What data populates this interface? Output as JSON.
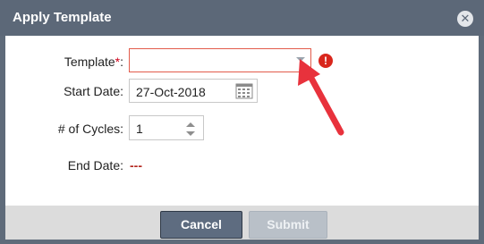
{
  "dialog": {
    "title": "Apply Template",
    "close_icon": "close-circle-icon"
  },
  "form": {
    "template_label": "Template",
    "required_marker": "*",
    "template_value": "",
    "error_icon": "exclamation-circle-icon",
    "start_date_label": "Start Date:",
    "start_date_value": "27-Oct-2018",
    "calendar_icon": "calendar-icon",
    "cycles_label": "# of Cycles:",
    "cycles_value": "1",
    "end_date_label": "End Date:",
    "end_date_value": "---"
  },
  "buttons": {
    "cancel": "Cancel",
    "submit": "Submit"
  },
  "annotation": {
    "arrow_color": "#e8323c"
  },
  "colors": {
    "titlebar": "#5c6878",
    "cancel_bg": "#5e6c80",
    "submit_disabled_bg": "#b9c0c8",
    "error_red": "#d9261c"
  }
}
